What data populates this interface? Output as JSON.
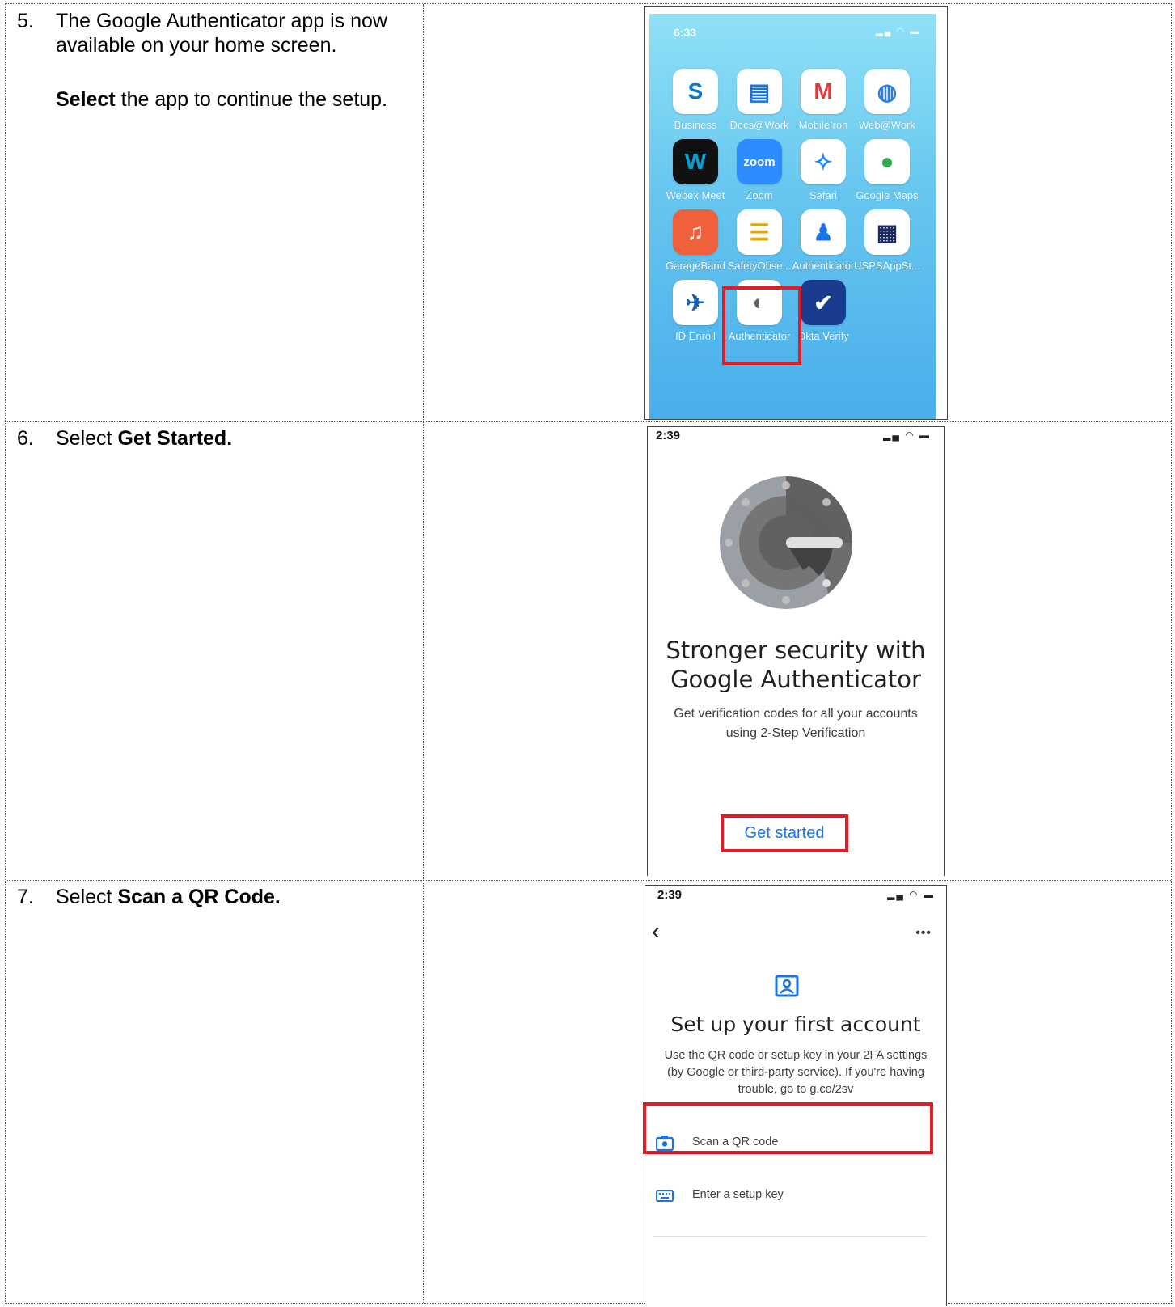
{
  "steps": [
    {
      "number": "5.",
      "line1": "The Google Authenticator app is now",
      "line2": "available on your home screen.",
      "sub_bold": "Select",
      "sub_rest": " the app to continue the setup."
    },
    {
      "number": "6.",
      "prefix": "Select ",
      "bold": "Get Started."
    },
    {
      "number": "7.",
      "prefix": "Select ",
      "bold": "Scan a QR Code."
    }
  ],
  "home_screen": {
    "time": "6:33",
    "status_icons": "signal-icon wifi-icon battery-icon",
    "apps": [
      {
        "label": "Business",
        "icon": "skype-business-icon",
        "glyph": "S",
        "color": "#0078d4"
      },
      {
        "label": "Docs@Work",
        "icon": "docs-icon",
        "glyph": "▤",
        "color": "#1e6fd9"
      },
      {
        "label": "MobileIron",
        "icon": "mobileiron-icon",
        "glyph": "M",
        "color": "#e23a3a"
      },
      {
        "label": "Web@Work",
        "icon": "globe-icon",
        "glyph": "◍",
        "color": "#2a7de1"
      },
      {
        "label": "Webex Meet",
        "icon": "webex-icon",
        "glyph": "W",
        "color": "#00a0d1"
      },
      {
        "label": "Zoom",
        "icon": "zoom-icon",
        "glyph": "zoom",
        "color": "#ffffff"
      },
      {
        "label": "Safari",
        "icon": "safari-icon",
        "glyph": "✧",
        "color": "#1a8cff"
      },
      {
        "label": "Google Maps",
        "icon": "maps-pin-icon",
        "glyph": "●",
        "color": "#34a853"
      },
      {
        "label": "GarageBand",
        "icon": "guitar-icon",
        "glyph": "♫",
        "color": "#ffffff"
      },
      {
        "label": "SafetyObse...",
        "icon": "safety-observation-icon",
        "glyph": "☰",
        "color": "#e0a800"
      },
      {
        "label": "Authenticator",
        "icon": "ms-authenticator-icon",
        "glyph": "♟",
        "color": "#1a73e8"
      },
      {
        "label": "USPSAppSt...",
        "icon": "usps-app-store-icon",
        "glyph": "▦",
        "color": "#1c2a5e"
      },
      {
        "label": "ID Enroll",
        "icon": "id-enroll-icon",
        "glyph": "✈",
        "color": "#1c5fa8"
      },
      {
        "label": "Authenticator",
        "icon": "google-authenticator-icon",
        "glyph": "◐",
        "color": "#5f6368"
      },
      {
        "label": "Okta Verify",
        "icon": "okta-verify-icon",
        "glyph": "✔",
        "color": "#ffffff"
      }
    ]
  },
  "get_started_screen": {
    "time": "2:39",
    "title_line1": "Stronger security with",
    "title_line2": "Google Authenticator",
    "desc_line1": "Get verification codes for all your accounts",
    "desc_line2": "using 2-Step Verification",
    "button": "Get started",
    "accent": "#1a73e8"
  },
  "setup_screen": {
    "time": "2:39",
    "more": "•••",
    "title": "Set up your first account",
    "desc_line1": "Use the QR code or setup key in your 2FA settings",
    "desc_line2": "(by Google or third-party service). If you're having",
    "desc_line3": "trouble, go to g.co/2sv",
    "options": [
      {
        "label": "Scan a QR code",
        "icon": "camera-icon"
      },
      {
        "label": "Enter a setup key",
        "icon": "keyboard-icon"
      }
    ]
  },
  "highlight_color": "#e21c24"
}
